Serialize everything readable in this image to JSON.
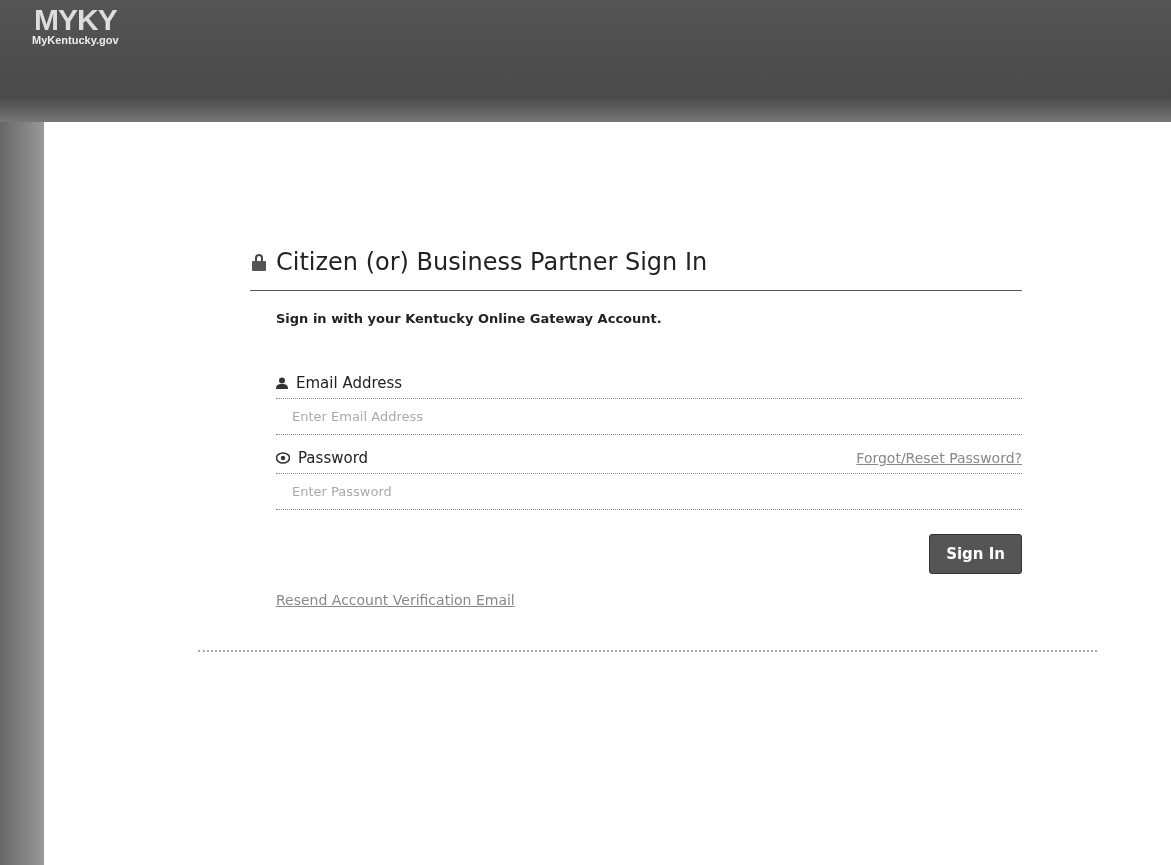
{
  "header": {
    "logo": "MYKY",
    "site": "MyKentucky.gov"
  },
  "signin": {
    "title": "Citizen (or) Business Partner Sign In",
    "intro": "Sign in with your Kentucky Online Gateway Account.",
    "email": {
      "label": "Email Address",
      "placeholder": "Enter Email Address"
    },
    "password": {
      "label": "Password",
      "placeholder": "Enter Password",
      "forgot_link": "Forgot/Reset Password?"
    },
    "submit": "Sign In",
    "resend_link": "Resend Account Verification Email"
  }
}
